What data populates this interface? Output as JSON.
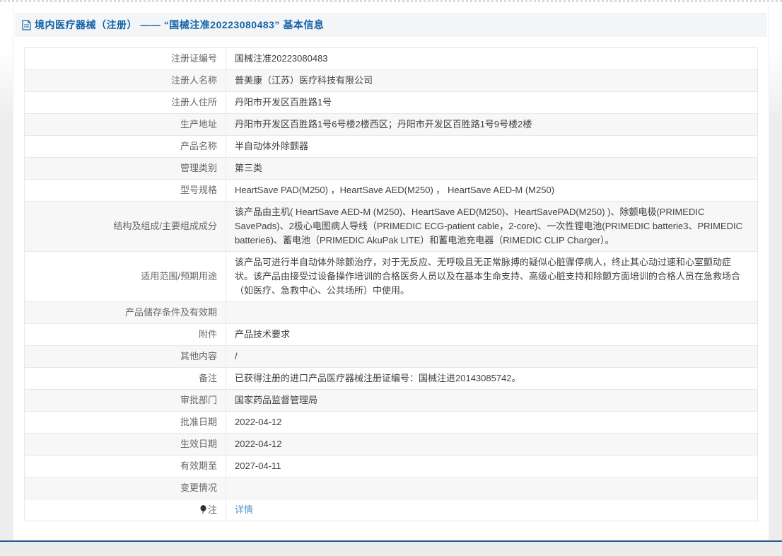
{
  "header": {
    "title": "境内医疗器械（注册） —— “国械注准20223080483” 基本信息"
  },
  "table": {
    "rows": [
      {
        "label": "注册证编号",
        "value": "国械注准20223080483"
      },
      {
        "label": "注册人名称",
        "value": "普美康（江苏）医疗科技有限公司"
      },
      {
        "label": "注册人住所",
        "value": "丹阳市开发区百胜路1号"
      },
      {
        "label": "生产地址",
        "value": "丹阳市开发区百胜路1号6号楼2楼西区；丹阳市开发区百胜路1号9号楼2楼"
      },
      {
        "label": "产品名称",
        "value": "半自动体外除颤器"
      },
      {
        "label": "管理类别",
        "value": "第三类"
      },
      {
        "label": "型号规格",
        "value": "HeartSave PAD(M250) ，HeartSave AED(M250) ， HeartSave AED-M (M250)"
      },
      {
        "label": "结构及组成/主要组成成分",
        "value": "该产品由主机( HeartSave AED-M (M250)、HeartSave AED(M250)、HeartSavePAD(M250) )、除颤电极(PRIMEDIC SavePads)、2极心电图病人导线（PRIMEDIC ECG-patient cable，2-core)、一次性锂电池(PRIMEDIC batterie3、PRIMEDIC batterie6)、蓄电池（PRIMEDIC AkuPak LITE）和蓄电池充电器（RIMEDIC CLIP Charger）。"
      },
      {
        "label": "适用范围/预期用途",
        "value": "该产品可进行半自动体外除颤治疗，对于无反应、无呼吸且无正常脉搏的疑似心脏骤停病人，终止其心动过速和心室颤动症状。该产品由接受过设备操作培训的合格医务人员以及在基本生命支持、高级心脏支持和除颤方面培训的合格人员在急救场合（如医疗、急救中心、公共场所）中使用。"
      },
      {
        "label": "产品储存条件及有效期",
        "value": ""
      },
      {
        "label": "附件",
        "value": "产品技术要求"
      },
      {
        "label": "其他内容",
        "value": "/"
      },
      {
        "label": "备注",
        "value": "已获得注册的进口产品医疗器械注册证编号：国械注进20143085742。"
      },
      {
        "label": "审批部门",
        "value": "国家药品监督管理局"
      },
      {
        "label": "批准日期",
        "value": "2022-04-12"
      },
      {
        "label": "生效日期",
        "value": "2022-04-12"
      },
      {
        "label": "有效期至",
        "value": "2027-04-11"
      },
      {
        "label": "变更情况",
        "value": ""
      },
      {
        "label": "注",
        "value": "详情",
        "is_link": true,
        "has_icon": true
      }
    ]
  },
  "colors": {
    "title_blue": "#1263a8",
    "link_blue": "#4d8fcc",
    "stripe_gray": "#f7f7f7",
    "bottom_line_blue": "#235f92"
  }
}
